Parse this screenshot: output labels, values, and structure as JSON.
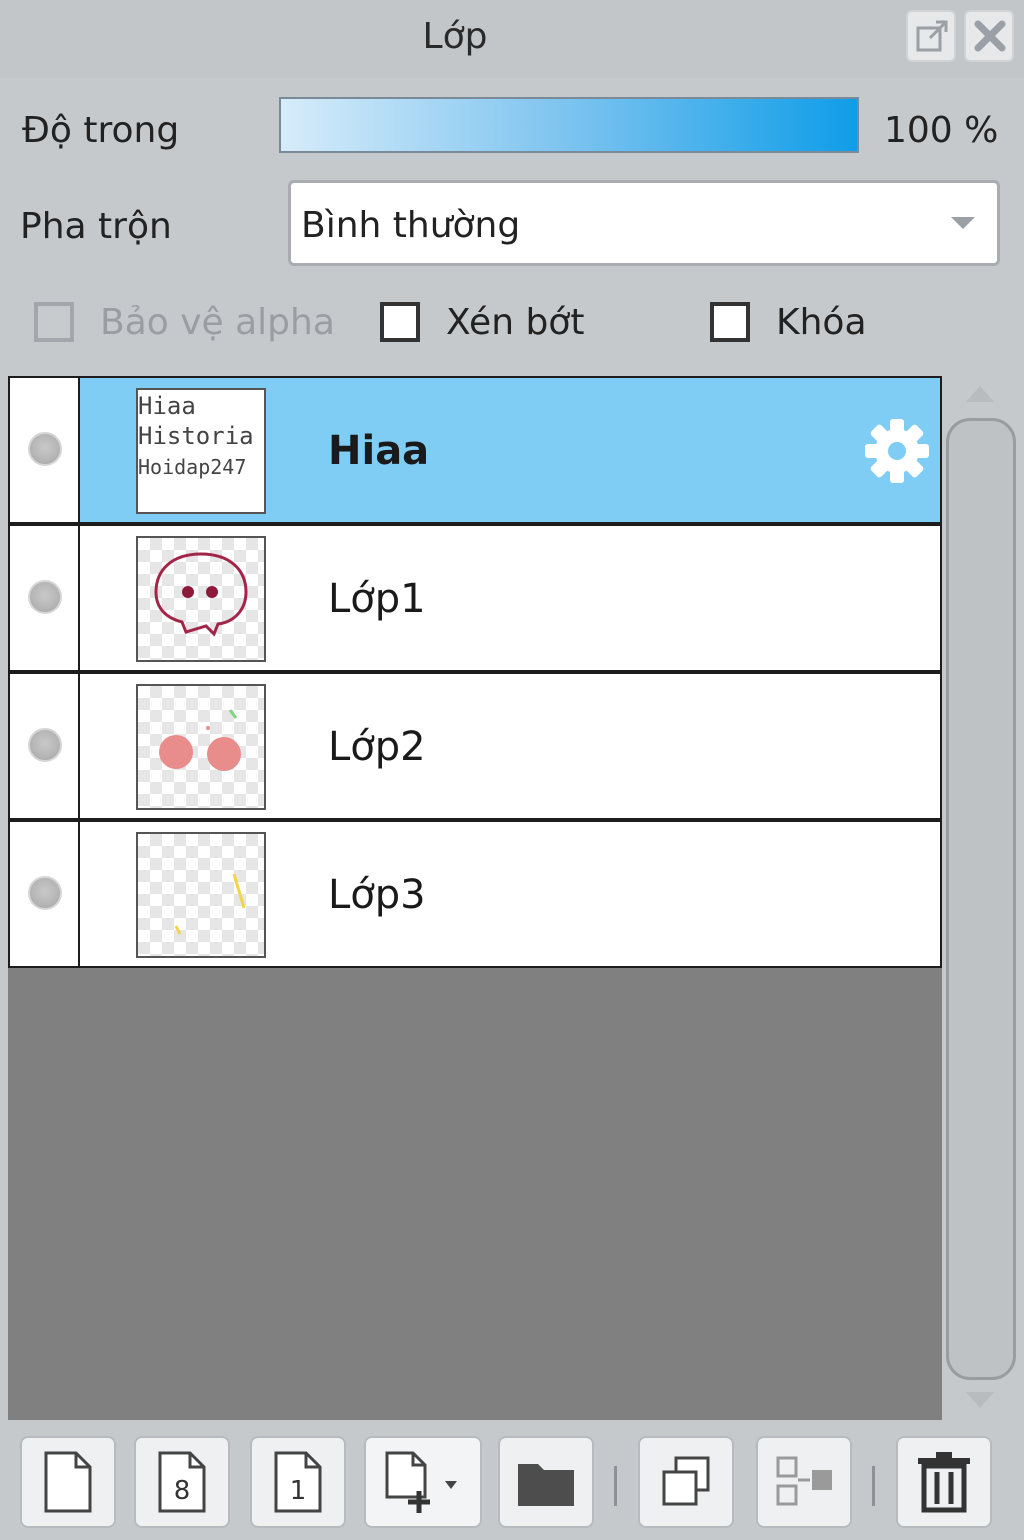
{
  "panel": {
    "title": "Lớp"
  },
  "opacity": {
    "label": "Độ trong",
    "value": "100 %",
    "level": 1.0
  },
  "blend": {
    "label": "Pha trộn",
    "selected": "Bình thường"
  },
  "checkboxes": {
    "protect_alpha": {
      "label": "Bảo vệ alpha",
      "checked": false,
      "disabled": true
    },
    "clip": {
      "label": "Xén bớt",
      "checked": false
    },
    "lock": {
      "label": "Khóa",
      "checked": false
    }
  },
  "layers": [
    {
      "name": "Hiaa",
      "active": true,
      "thumb_text": [
        "Hiaa",
        "Historia",
        "Hoidap247"
      ]
    },
    {
      "name": "Lớp1",
      "active": false
    },
    {
      "name": "Lớp2",
      "active": false
    },
    {
      "name": "Lớp3",
      "active": false
    }
  ],
  "toolbar": {
    "icons": [
      "new-layer-icon",
      "new-8bit-layer-icon",
      "new-1bit-layer-icon",
      "add-layer-dropdown-icon",
      "new-folder-icon",
      "duplicate-layer-icon",
      "merge-layer-icon",
      "delete-layer-icon"
    ]
  },
  "colors": {
    "active_layer": "#7fcdf5",
    "opacity_bar": "#0f9de8"
  }
}
